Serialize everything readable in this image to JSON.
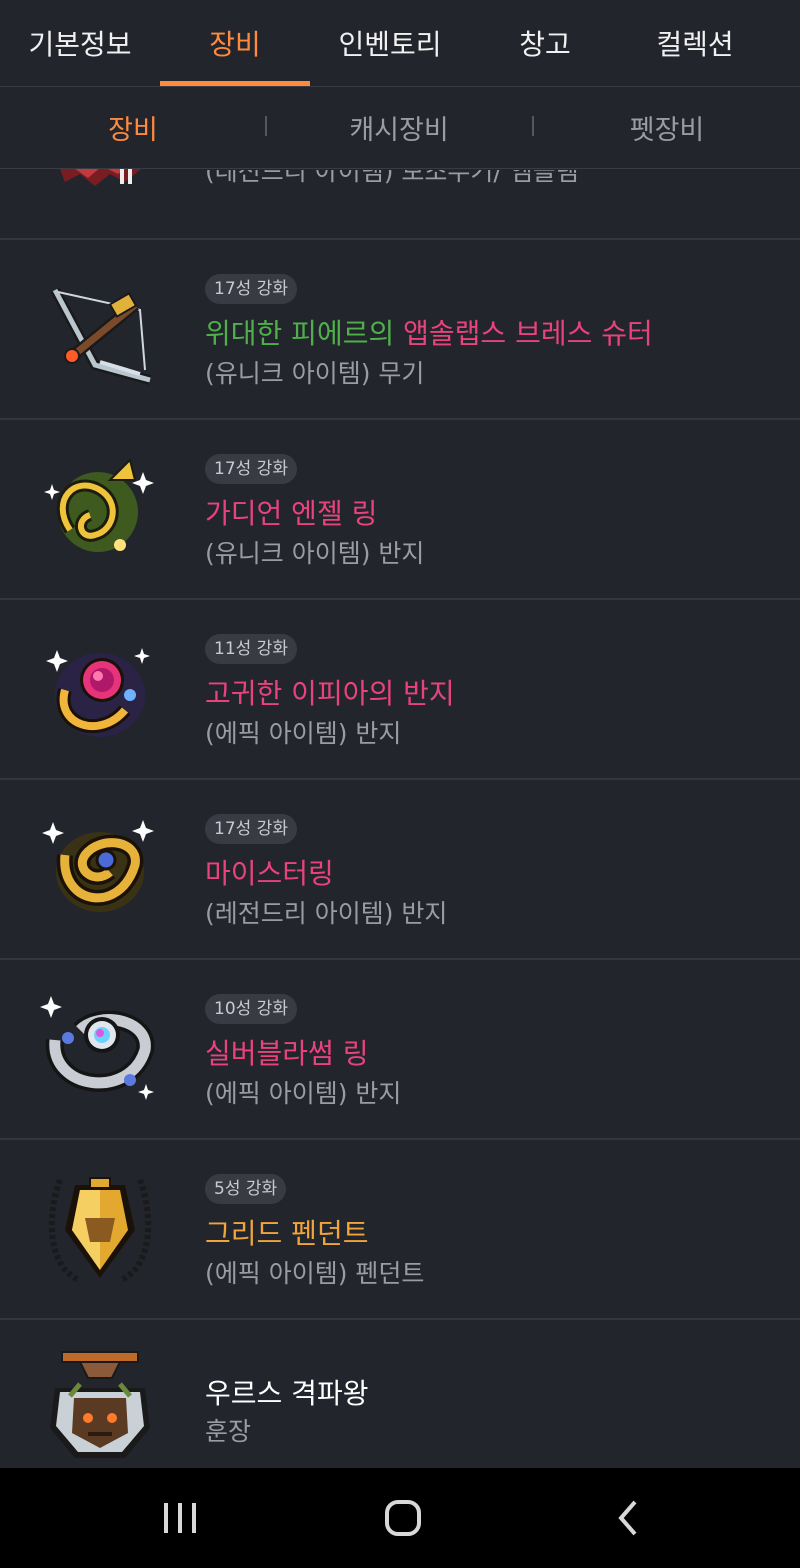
{
  "tabs": [
    "기본정보",
    "장비",
    "인벤토리",
    "창고",
    "컬렉션"
  ],
  "subtabs": [
    "장비",
    "캐시장비",
    "펫장비"
  ],
  "partial_item": {
    "type": "(레전드리 아이템) 보조무기/ 엠블렘"
  },
  "items": [
    {
      "badge": "17성 강화",
      "name_prefix": "위대한 피에르의 ",
      "name": "앱솔랩스 브레스 슈터",
      "type": "(유니크 아이템) 무기",
      "name_color": "#e8437b",
      "prefix_color": "#4fb04a",
      "icon": "crossbow-icon"
    },
    {
      "badge": "17성 강화",
      "name": "가디언 엔젤 링",
      "type": "(유니크 아이템) 반지",
      "name_color": "#e8437b",
      "icon": "guardian-angel-ring-icon"
    },
    {
      "badge": "11성 강화",
      "name": "고귀한 이피아의 반지",
      "type": "(에픽 아이템) 반지",
      "name_color": "#e8437b",
      "icon": "rose-ring-icon"
    },
    {
      "badge": "17성 강화",
      "name": "마이스터링",
      "type": "(레전드리 아이템) 반지",
      "name_color": "#e8437b",
      "icon": "gold-ring-icon"
    },
    {
      "badge": "10성 강화",
      "name": "실버블라썸 링",
      "type": "(에픽 아이템) 반지",
      "name_color": "#e8437b",
      "icon": "silver-ring-icon"
    },
    {
      "badge": "5성 강화",
      "name": "그리드 펜던트",
      "type": "(에픽 아이템) 펜던트",
      "name_color": "#f0a43a",
      "icon": "pendant-icon"
    },
    {
      "name": "우르스 격파왕",
      "type": "훈장",
      "name_color": "#ffffff",
      "icon": "medal-icon"
    }
  ],
  "colors": {
    "accent": "#ff8a3d",
    "background": "#23252d"
  }
}
